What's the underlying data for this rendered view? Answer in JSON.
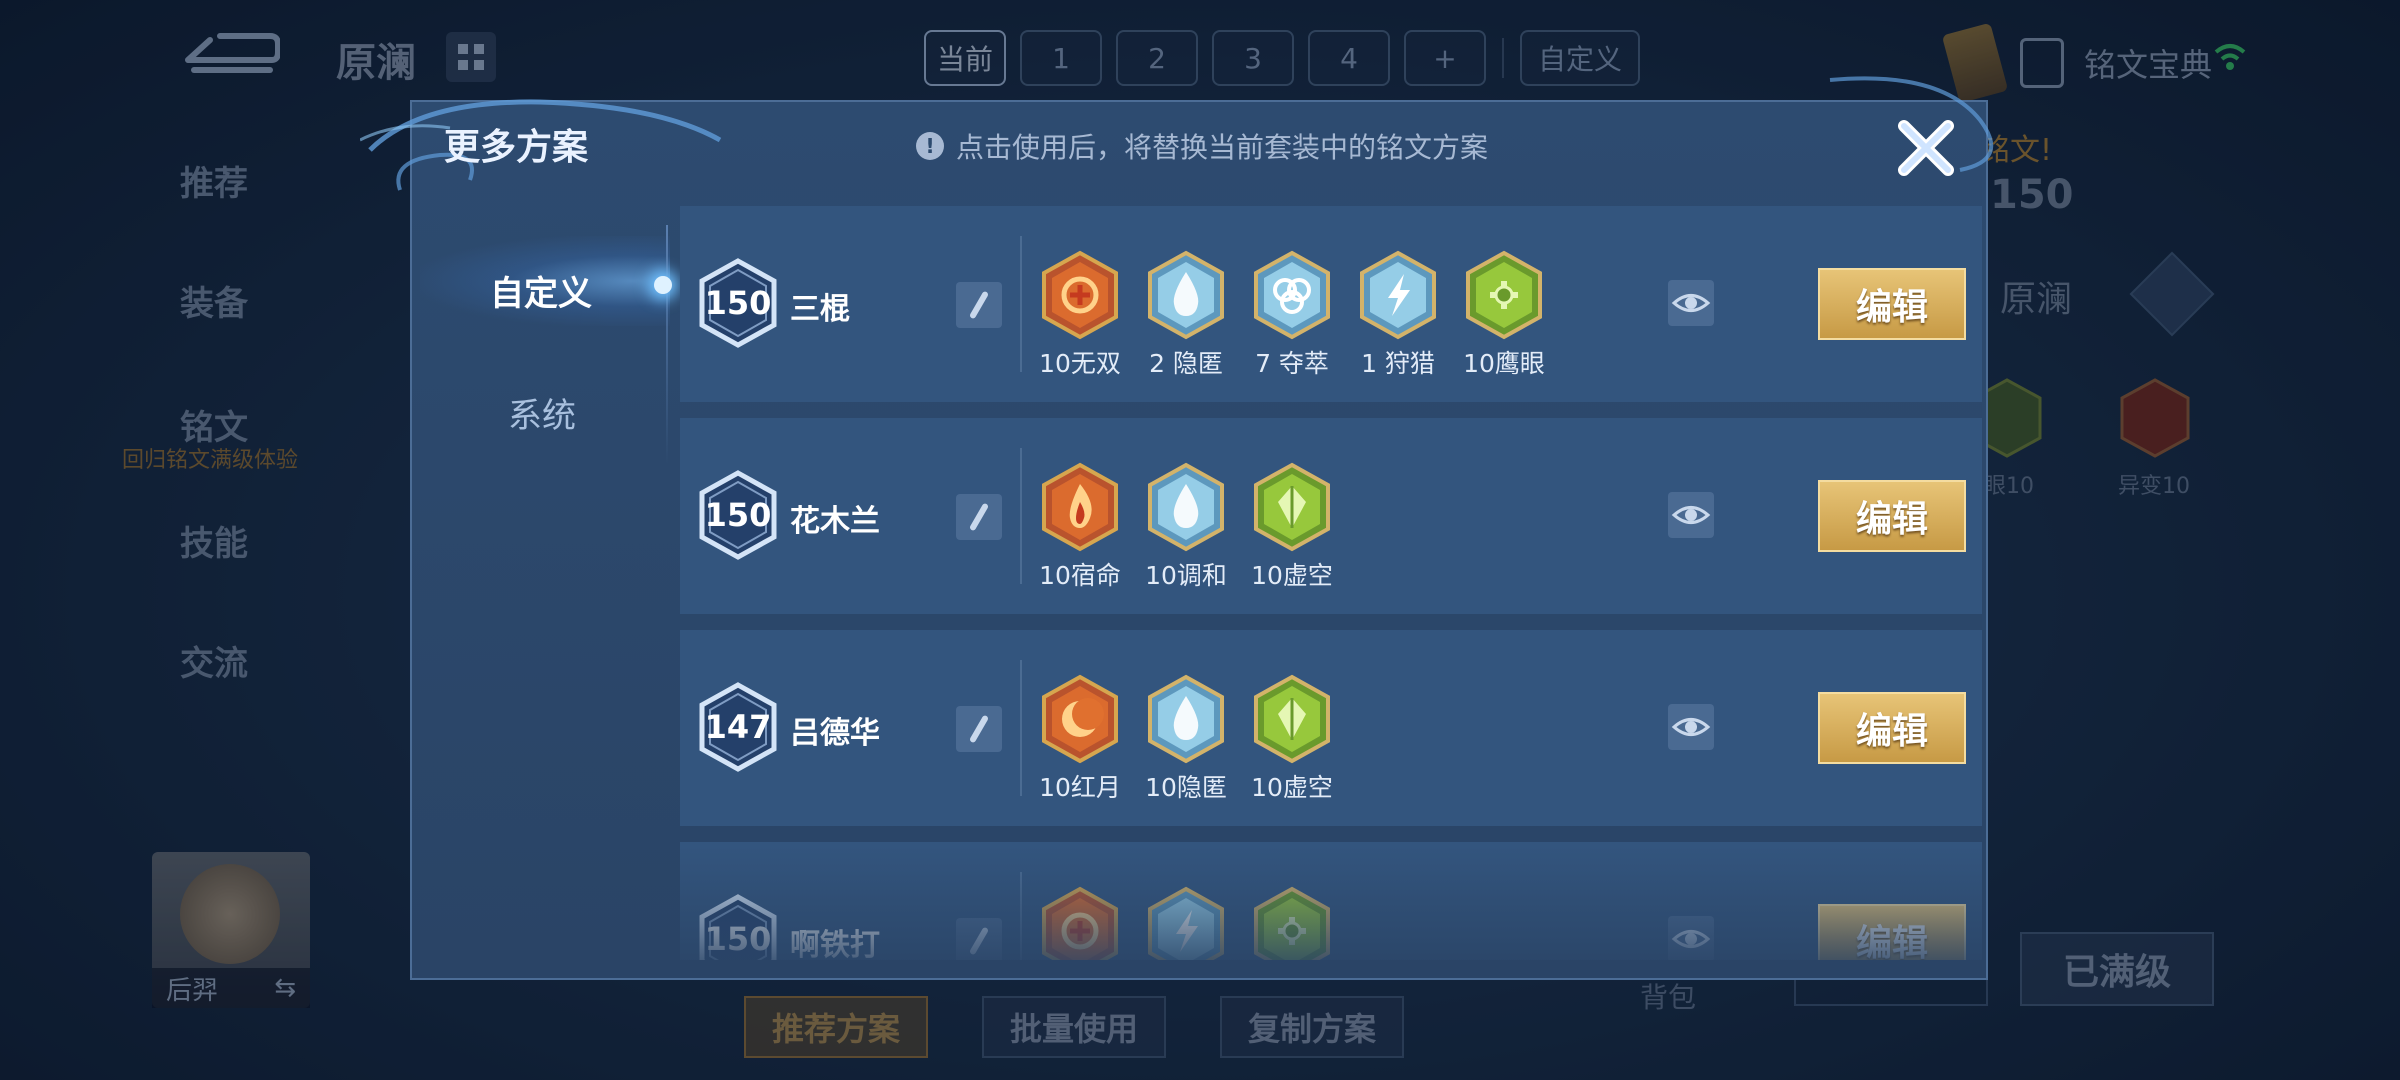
{
  "header": {
    "hero_title": "原澜",
    "page_tabs": [
      {
        "label": "当前",
        "current": true
      },
      {
        "label": "1"
      },
      {
        "label": "2"
      },
      {
        "label": "3"
      },
      {
        "label": "4"
      },
      {
        "label": "+"
      },
      {
        "label": "自定义"
      }
    ],
    "codex_label": "铭文宝典"
  },
  "left_nav": {
    "items": [
      "推荐",
      "装备",
      "铭文",
      "技能",
      "交流"
    ],
    "rune_sub": "回归铭文满级体验"
  },
  "hero_card": {
    "name": "后羿",
    "swap_icon": "⇆"
  },
  "bottom_buttons": [
    "推荐方案",
    "批量使用",
    "复制方案"
  ],
  "pack_label": "背包",
  "maxed_label": "已满级",
  "right_panel": {
    "notice": "铭文!",
    "level": "150",
    "name": "原澜",
    "rune_labels": [
      "眼10",
      "异变10"
    ]
  },
  "modal": {
    "title": "更多方案",
    "notice": "点击使用后，将替换当前套装中的铭文方案",
    "close_icon": "close-x-icon",
    "tabs": [
      "自定义",
      "系统"
    ],
    "active_tab": "自定义",
    "edit_label": "编辑",
    "plans": [
      {
        "level": "150",
        "name": "三棍",
        "runes": [
          {
            "label": "10无双",
            "color": "red",
            "icon": "swirl-icon"
          },
          {
            "label": "2 隐匿",
            "color": "blue",
            "icon": "droplet-icon"
          },
          {
            "label": "7 夺萃",
            "color": "blue",
            "icon": "triquetra-icon"
          },
          {
            "label": "1 狩猎",
            "color": "blue",
            "icon": "lightning-icon"
          },
          {
            "label": "10鹰眼",
            "color": "green",
            "icon": "eye-cross-icon"
          }
        ]
      },
      {
        "level": "150",
        "name": "花木兰",
        "runes": [
          {
            "label": "10宿命",
            "color": "red",
            "icon": "flame-icon"
          },
          {
            "label": "10调和",
            "color": "blue",
            "icon": "droplet-icon"
          },
          {
            "label": "10虚空",
            "color": "green",
            "icon": "crystal-icon"
          }
        ]
      },
      {
        "level": "147",
        "name": "吕德华",
        "runes": [
          {
            "label": "10红月",
            "color": "red",
            "icon": "crescent-icon"
          },
          {
            "label": "10隐匿",
            "color": "blue",
            "icon": "droplet-icon"
          },
          {
            "label": "10虚空",
            "color": "green",
            "icon": "crystal-icon"
          }
        ]
      },
      {
        "level": "150",
        "name": "啊铁打",
        "runes": [
          {
            "label": "",
            "color": "red",
            "icon": "swirl-icon"
          },
          {
            "label": "",
            "color": "blue",
            "icon": "lightning-icon"
          },
          {
            "label": "",
            "color": "green",
            "icon": "eye-cross-icon"
          }
        ]
      }
    ]
  },
  "colors": {
    "modal_bg": "#2d4b70",
    "row_bg": "#33557e",
    "edit_gold": "#d4a952",
    "rune_red": "#d2542a",
    "rune_blue": "#7fc6e6",
    "rune_green": "#8bc43a"
  }
}
